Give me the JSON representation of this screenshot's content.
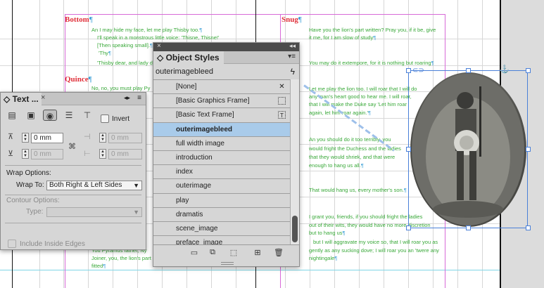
{
  "document": {
    "speakers": [
      "Bottom",
      "Quince",
      "Snug"
    ],
    "bottom_lines": [
      "An I may hide my face, let me play Thisby too.",
      "I'll speak in a monstrous little voice: 'Thisne, Thisne!'",
      "[Then speaking small].",
      "'Thy",
      "'Thisby dear, and lady d"
    ],
    "quince_line": "No, no, you must play Py",
    "lower_left_lines": [
      "You Pyramus father, Ny",
      "Joiner, you, the lion's part",
      "fitted"
    ],
    "snug_lines": [
      "Have you the lion's part written? Pray you, if it be, give",
      "it me, for I am slow of study"
    ],
    "quince_right_1": "You may do it extempore, for it is nothing but roaring",
    "bottom_right_1": [
      "Let me play the lion too. I will roar that I will do",
      "any man's heart good to hear me. I will roar,",
      "that I will make the Duke say 'Let him roar",
      "again, let him roar again.'"
    ],
    "quince_right_2": [
      "An you should do it too terribly, you",
      "would fright the Duchess and the ladies",
      "that they would shriek, and that were",
      "enough to hang us all."
    ],
    "all_line": "That would hang us, every mother's son.",
    "bottom_right_2": [
      "I grant you, friends, if you should fright the ladies",
      "out of their wits, they would have no more discretion",
      "but to hang us",
      "but I will aggravate my voice so, that I will roar you as",
      "gently as any sucking dove; I will roar you an 'twere any",
      "nightingale"
    ],
    "pilcrow": "¶",
    "colors": {
      "speaker": "#e0303a",
      "verse": "#38a838",
      "frame": "#4a80d8",
      "selection": "#a9cbea"
    }
  },
  "object_styles": {
    "title": "Object Styles",
    "current_style": "outerimagebleed",
    "styles": [
      {
        "label": "[None]",
        "icon": "clear-override-icon"
      },
      {
        "label": "[Basic Graphics Frame]",
        "icon": "graphics-frame-icon"
      },
      {
        "label": "[Basic Text Frame]",
        "icon": "text-frame-icon"
      },
      {
        "label": "outerimagebleed",
        "selected": true
      },
      {
        "label": "full width image"
      },
      {
        "label": "introduction"
      },
      {
        "label": "index"
      },
      {
        "label": "outerimage"
      },
      {
        "label": "play"
      },
      {
        "label": "dramatis"
      },
      {
        "label": "scene_image"
      },
      {
        "label": "preface_image"
      }
    ],
    "footer_icons": [
      "new-group-icon",
      "link-style-icon",
      "clear-overrides-icon",
      "new-style-icon",
      "delete-icon"
    ]
  },
  "text_wrap": {
    "title": "Text ...",
    "invert_label": "Invert",
    "offset_top": "0 mm",
    "offset_bottom": "0 mm",
    "offset_left": "0 mm",
    "offset_right": "0 mm",
    "wrap_options_label": "Wrap Options:",
    "wrap_to_label": "Wrap To:",
    "wrap_to_value": "Both Right & Left Sides",
    "contour_options_label": "Contour Options:",
    "type_label": "Type:",
    "type_value": "",
    "include_inside_edges_label": "Include Inside Edges"
  }
}
